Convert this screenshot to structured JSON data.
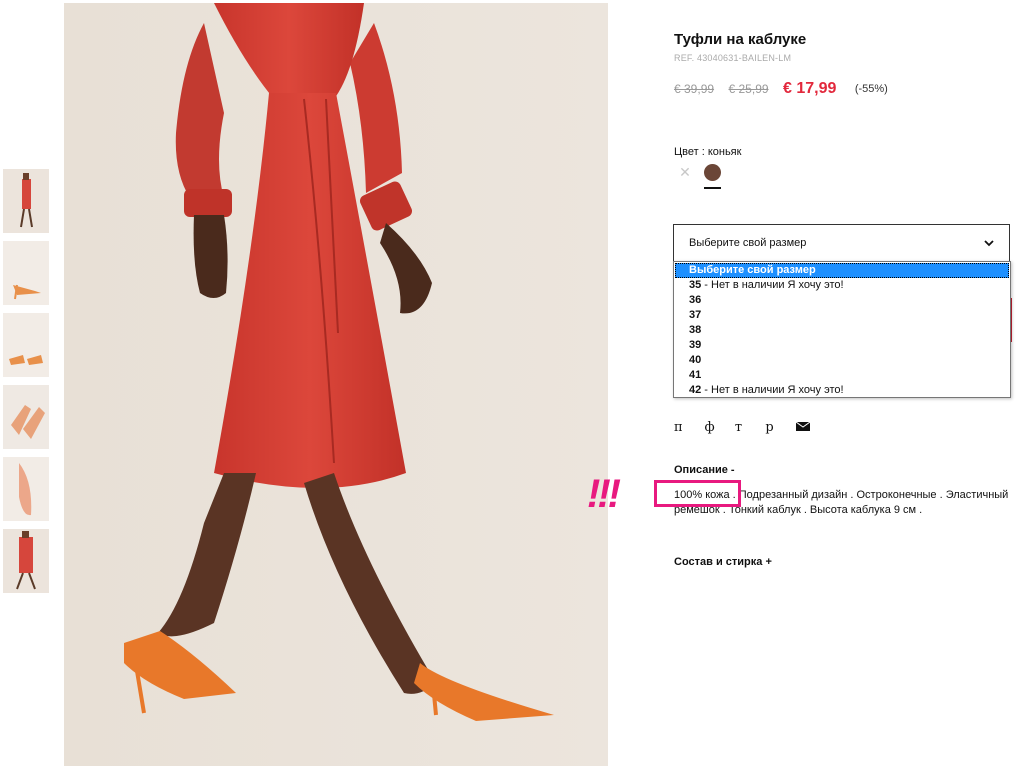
{
  "product": {
    "title": "Туфли на каблуке",
    "ref": "REF. 43040631-BAILEN-LM",
    "prices": {
      "old1": "€ 39,99",
      "old2": "€ 25,99",
      "current": "€ 17,99",
      "discount": "(-55%)"
    },
    "price_color": "#e2283c"
  },
  "color": {
    "label": "Цвет : коньяк",
    "unavailable_icon": "close-icon",
    "swatch_color": "#6b4637"
  },
  "size": {
    "placeholder": "Выберите свой размер",
    "options": [
      {
        "size": "Выберите свой размер",
        "note": ""
      },
      {
        "size": "35",
        "note": " - Нет в наличии Я хочу это!"
      },
      {
        "size": "36",
        "note": ""
      },
      {
        "size": "37",
        "note": ""
      },
      {
        "size": "38",
        "note": ""
      },
      {
        "size": "39",
        "note": ""
      },
      {
        "size": "40",
        "note": ""
      },
      {
        "size": "41",
        "note": ""
      },
      {
        "size": "42",
        "note": " - Нет в наличии Я хочу это!"
      }
    ],
    "selected_index": 0,
    "highlight_color": "#1e90ff"
  },
  "social": {
    "items": [
      "п",
      "ф",
      "т",
      "р"
    ],
    "mail_icon": "mail-icon"
  },
  "description": {
    "heading": "Описание  -",
    "highlight": "100% кожа",
    "text": " . Подрезанный дизайн . Остроконечные . Эластичный ремешок . Тонкий каблук . Высота каблука 9 см ."
  },
  "annotation": {
    "marks": "!!!",
    "color": "#e8197f"
  },
  "composition": {
    "heading": "Состав и стирка  +"
  }
}
